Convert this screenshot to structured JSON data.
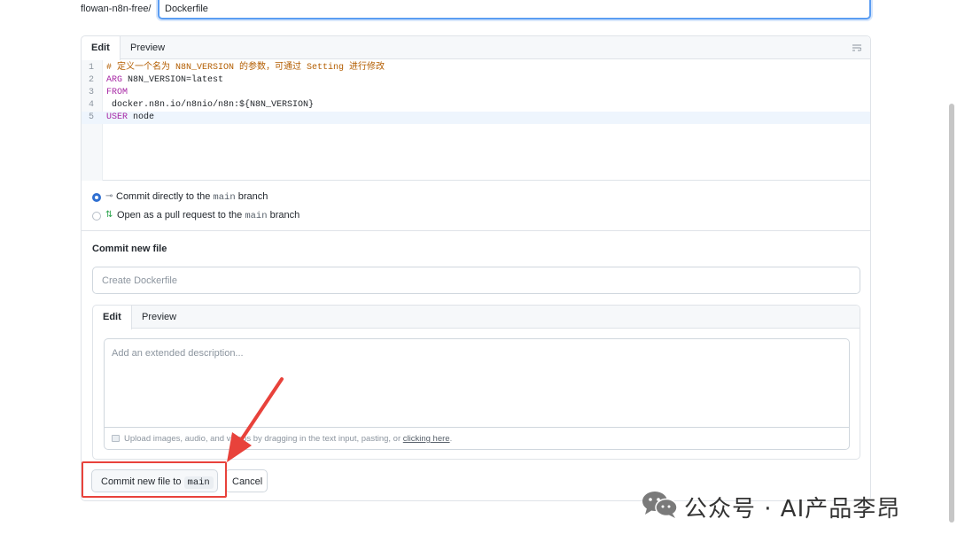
{
  "path": {
    "prefix": "flowan-n8n-free/",
    "filename": "Dockerfile"
  },
  "editor": {
    "tabs": [
      {
        "label": "Edit",
        "active": true
      },
      {
        "label": "Preview",
        "active": false
      }
    ],
    "lines": [
      {
        "num": "1",
        "keyword": "",
        "text": "# 定义一个名为 N8N_VERSION 的参数，可通过 Setting 进行修改",
        "kind": "comment"
      },
      {
        "num": "2",
        "keyword": "ARG",
        "text": " N8N_VERSION=latest",
        "kind": "code"
      },
      {
        "num": "3",
        "keyword": "FROM",
        "text": "",
        "kind": "code"
      },
      {
        "num": "4",
        "keyword": "",
        "text": " docker.n8n.io/n8nio/n8n:${N8N_VERSION}",
        "kind": "code"
      },
      {
        "num": "5",
        "keyword": "USER",
        "text": " node",
        "kind": "code",
        "current": true
      }
    ]
  },
  "commit_options": {
    "direct": {
      "prefix": "Commit directly to the ",
      "branch": "main",
      "suffix": " branch",
      "checked": true
    },
    "pull_request": {
      "prefix": "Open as a pull request to the ",
      "branch": "main",
      "suffix": " branch",
      "checked": false
    }
  },
  "commit": {
    "title": "Commit new file",
    "summary_placeholder": "Create Dockerfile",
    "desc_tabs": [
      {
        "label": "Edit",
        "active": true
      },
      {
        "label": "Preview",
        "active": false
      }
    ],
    "description_placeholder": "Add an extended description...",
    "upload_text": "Upload images, audio, and videos by dragging in the text input, pasting, or ",
    "upload_link": "clicking here",
    "upload_end": "."
  },
  "buttons": {
    "commit_prefix": "Commit new file to ",
    "commit_branch": "main",
    "cancel": "Cancel"
  },
  "watermark": {
    "text": "公众号 · AI产品李昂"
  },
  "colors": {
    "focus_border": "#5b9df2",
    "radio_checked": "#2f6fd1",
    "annotation_red": "#e8423b",
    "keyword": "#a626a4",
    "comment": "#b35d00"
  }
}
